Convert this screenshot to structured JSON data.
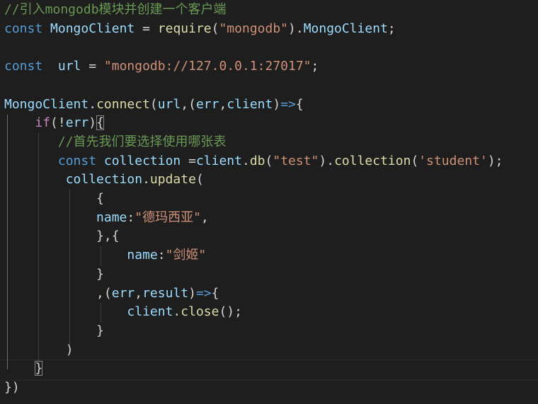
{
  "editor": {
    "language": "javascript",
    "theme": "dark",
    "lines": [
      {
        "tokens": [
          {
            "t": "//引入mongodb模块并创建一个客户端",
            "c": "c"
          }
        ]
      },
      {
        "tokens": [
          {
            "t": "const",
            "c": "kw"
          },
          {
            "t": " ",
            "c": "p"
          },
          {
            "t": "MongoClient",
            "c": "v"
          },
          {
            "t": " = ",
            "c": "p"
          },
          {
            "t": "require",
            "c": "fn"
          },
          {
            "t": "(",
            "c": "p"
          },
          {
            "t": "\"mongodb\"",
            "c": "s"
          },
          {
            "t": ").",
            "c": "p"
          },
          {
            "t": "MongoClient",
            "c": "v"
          },
          {
            "t": ";",
            "c": "p"
          }
        ]
      },
      {
        "tokens": []
      },
      {
        "tokens": [
          {
            "t": "const",
            "c": "kw"
          },
          {
            "t": "  ",
            "c": "p"
          },
          {
            "t": "url",
            "c": "v"
          },
          {
            "t": " = ",
            "c": "p"
          },
          {
            "t": "\"mongodb://127.0.0.1:27017\"",
            "c": "s"
          },
          {
            "t": ";",
            "c": "p"
          }
        ]
      },
      {
        "tokens": []
      },
      {
        "tokens": [
          {
            "t": "MongoClient",
            "c": "v"
          },
          {
            "t": ".",
            "c": "p"
          },
          {
            "t": "connect",
            "c": "fn"
          },
          {
            "t": "(",
            "c": "p"
          },
          {
            "t": "url",
            "c": "v"
          },
          {
            "t": ",(",
            "c": "p"
          },
          {
            "t": "err",
            "c": "v"
          },
          {
            "t": ",",
            "c": "p"
          },
          {
            "t": "client",
            "c": "v"
          },
          {
            "t": ")",
            "c": "p"
          },
          {
            "t": "=>",
            "c": "kw"
          },
          {
            "t": "{",
            "c": "p"
          }
        ]
      },
      {
        "tokens": [
          {
            "t": "    ",
            "c": "p"
          },
          {
            "t": "if",
            "c": "ct"
          },
          {
            "t": "(!",
            "c": "p"
          },
          {
            "t": "err",
            "c": "v"
          },
          {
            "t": ")",
            "c": "p"
          },
          {
            "t": "{",
            "c": "p",
            "match": true
          }
        ]
      },
      {
        "tokens": [
          {
            "t": "       ",
            "c": "p"
          },
          {
            "t": "//首先我们要选择使用哪张表",
            "c": "c"
          }
        ]
      },
      {
        "tokens": [
          {
            "t": "       ",
            "c": "p"
          },
          {
            "t": "const",
            "c": "kw"
          },
          {
            "t": " ",
            "c": "p"
          },
          {
            "t": "collection",
            "c": "v"
          },
          {
            "t": " =",
            "c": "p"
          },
          {
            "t": "client",
            "c": "v"
          },
          {
            "t": ".",
            "c": "p"
          },
          {
            "t": "db",
            "c": "fn"
          },
          {
            "t": "(",
            "c": "p"
          },
          {
            "t": "\"test\"",
            "c": "s"
          },
          {
            "t": ").",
            "c": "p"
          },
          {
            "t": "collection",
            "c": "fn"
          },
          {
            "t": "(",
            "c": "p"
          },
          {
            "t": "'student'",
            "c": "s"
          },
          {
            "t": ");",
            "c": "p"
          }
        ]
      },
      {
        "tokens": [
          {
            "t": "        ",
            "c": "p"
          },
          {
            "t": "collection",
            "c": "v"
          },
          {
            "t": ".",
            "c": "p"
          },
          {
            "t": "update",
            "c": "fn"
          },
          {
            "t": "(",
            "c": "p"
          }
        ]
      },
      {
        "tokens": [
          {
            "t": "            ",
            "c": "p"
          },
          {
            "t": "{",
            "c": "p"
          }
        ]
      },
      {
        "tokens": [
          {
            "t": "            ",
            "c": "p"
          },
          {
            "t": "name",
            "c": "v"
          },
          {
            "t": ":",
            "c": "p"
          },
          {
            "t": "\"德玛西亚\"",
            "c": "s"
          },
          {
            "t": ",",
            "c": "p"
          }
        ]
      },
      {
        "tokens": [
          {
            "t": "            ",
            "c": "p"
          },
          {
            "t": "},{",
            "c": "p"
          }
        ]
      },
      {
        "tokens": [
          {
            "t": "                ",
            "c": "p"
          },
          {
            "t": "name",
            "c": "v"
          },
          {
            "t": ":",
            "c": "p"
          },
          {
            "t": "\"剑姬\"",
            "c": "s"
          }
        ]
      },
      {
        "tokens": [
          {
            "t": "            ",
            "c": "p"
          },
          {
            "t": "}",
            "c": "p"
          }
        ]
      },
      {
        "tokens": [
          {
            "t": "            ",
            "c": "p"
          },
          {
            "t": ",(",
            "c": "p"
          },
          {
            "t": "err",
            "c": "v"
          },
          {
            "t": ",",
            "c": "p"
          },
          {
            "t": "result",
            "c": "v"
          },
          {
            "t": ")",
            "c": "p"
          },
          {
            "t": "=>",
            "c": "kw"
          },
          {
            "t": "{",
            "c": "p"
          }
        ]
      },
      {
        "tokens": [
          {
            "t": "                ",
            "c": "p"
          },
          {
            "t": "client",
            "c": "v"
          },
          {
            "t": ".",
            "c": "p"
          },
          {
            "t": "close",
            "c": "fn"
          },
          {
            "t": "();",
            "c": "p"
          }
        ]
      },
      {
        "tokens": [
          {
            "t": "            ",
            "c": "p"
          },
          {
            "t": "}",
            "c": "p"
          }
        ]
      },
      {
        "tokens": [
          {
            "t": "        ",
            "c": "p"
          },
          {
            "t": ")",
            "c": "p"
          }
        ]
      },
      {
        "tokens": [
          {
            "t": "    ",
            "c": "p"
          },
          {
            "t": "}",
            "c": "p",
            "match": true
          }
        ]
      },
      {
        "tokens": [
          {
            "t": "})",
            "c": "p"
          }
        ]
      }
    ]
  }
}
